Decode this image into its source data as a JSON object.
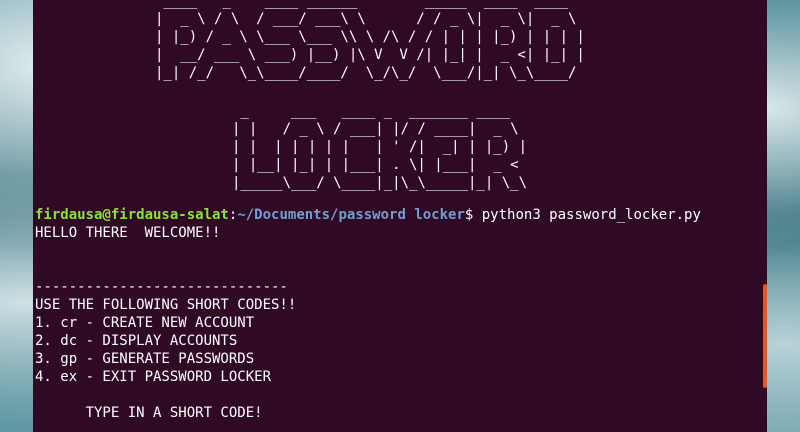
{
  "banner": {
    "password_art": [
      " ____   _    ____ ______        _____  ____  ____  ",
      "|  _ \\ / \\  / ___/ ___\\ \\      / / _ \\|  _ \\|  _ \\ ",
      "| |_) / _ \\ \\___ \\___ \\\\ \\ /\\ / / | | | |_) | | | |",
      "|  __/ ___ \\ ___) |__) |\\ V  V /| |_| |  _ <| |_| |",
      "|_| /_/   \\_\\____/____/  \\_/\\_/  \\___/|_| \\_\\____/ "
    ],
    "locker_art": [
      " _     ___   ____ _  _______ ____  ",
      "| |   / _ \\ / ___| |/ / ____|  _ \\ ",
      "| |  | | | | |   | ' /|  _| | |_) |",
      "| |__| |_| | |___| . \\| |___|  _ < ",
      "|_____\\___/ \\____|_|\\_\\_____|_| \\_\\"
    ]
  },
  "prompt": {
    "user_host": "firdausa@firdausa-salat",
    "separator": ":",
    "path": "~/Documents/password locker",
    "symbol": "$",
    "command": " python3 password_locker.py"
  },
  "output": {
    "greeting": "HELLO THERE  WELCOME!!",
    "divider": "------------------------------",
    "instructions": "USE THE FOLLOWING SHORT CODES!!",
    "codes": [
      "1. cr - CREATE NEW ACCOUNT",
      "2. dc - DISPLAY ACCOUNTS",
      "3. gp - GENERATE PASSWORDS",
      "4. ex - EXIT PASSWORD LOCKER"
    ],
    "input_prompt": "      TYPE IN A SHORT CODE!"
  },
  "colors": {
    "terminal_bg": "#300a24",
    "user_host": "#8ae234",
    "path": "#729fcf",
    "scrollbar": "#e95420"
  }
}
